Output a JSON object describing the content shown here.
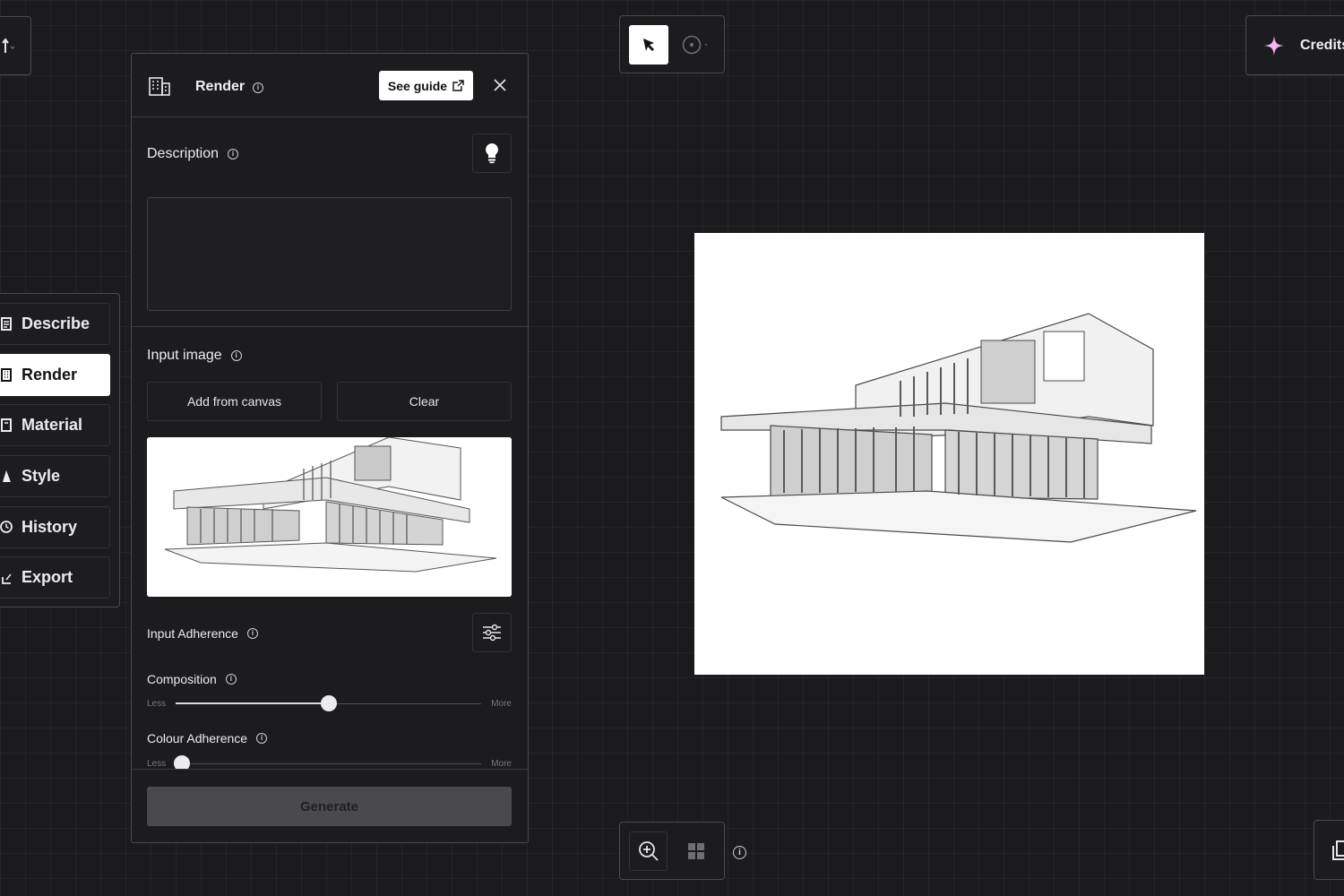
{
  "panel": {
    "title": "Render",
    "guide_label": "See guide",
    "description_label": "Description",
    "description_value": "",
    "input_image_label": "Input image",
    "add_from_canvas_label": "Add from canvas",
    "clear_label": "Clear",
    "input_adherence_label": "Input Adherence",
    "composition": {
      "label": "Composition",
      "less": "Less",
      "more": "More",
      "value": 0.5
    },
    "colour_adherence": {
      "label": "Colour Adherence",
      "less": "Less",
      "more": "More",
      "value": 0.02
    },
    "generate_label": "Generate"
  },
  "nav": {
    "items": [
      {
        "label": "Describe",
        "icon": "describe-icon",
        "active": false
      },
      {
        "label": "Render",
        "icon": "building-icon",
        "active": true
      },
      {
        "label": "Material",
        "icon": "material-icon",
        "active": false
      },
      {
        "label": "Style",
        "icon": "style-icon",
        "active": false
      },
      {
        "label": "History",
        "icon": "history-icon",
        "active": false
      },
      {
        "label": "Export",
        "icon": "export-icon",
        "active": false
      }
    ]
  },
  "header": {
    "credits_label": "Credits"
  },
  "colors": {
    "background": "#1b1b1d",
    "panel": "#1c1c1f",
    "accent": "#ffffff",
    "credits_icon": "#f4b6f0",
    "generate_disabled": "#4a4a4d"
  }
}
